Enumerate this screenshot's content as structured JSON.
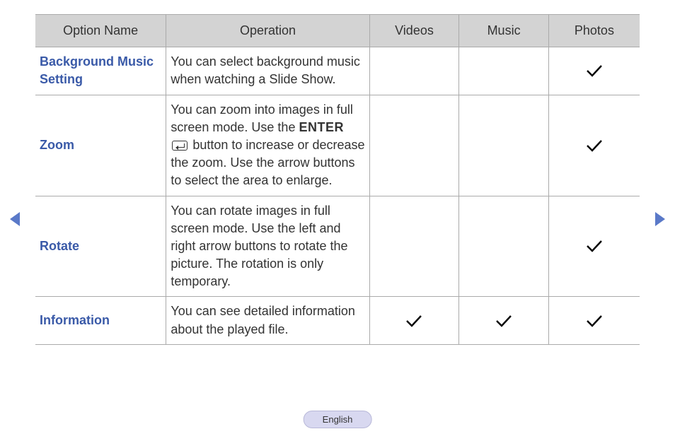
{
  "headers": {
    "option": "Option Name",
    "operation": "Operation",
    "videos": "Videos",
    "music": "Music",
    "photos": "Photos"
  },
  "rows": [
    {
      "name": "Background Music Setting",
      "operation": "You can select background music when watching a Slide Show.",
      "videos": false,
      "music": false,
      "photos": true,
      "has_enter_icon": false
    },
    {
      "name": "Zoom",
      "op_pre": "You can zoom into images in full screen mode. Use the ",
      "op_enter_word": "ENTER",
      "op_post": " button to increase or decrease the zoom. Use the arrow buttons to select the area to enlarge.",
      "videos": false,
      "music": false,
      "photos": true,
      "has_enter_icon": true
    },
    {
      "name": "Rotate",
      "operation": "You can rotate images in full screen mode. Use the left and right arrow buttons to rotate the picture. The rotation is only temporary.",
      "videos": false,
      "music": false,
      "photos": true,
      "has_enter_icon": false
    },
    {
      "name": "Information",
      "operation": "You can see detailed information about the played file.",
      "videos": true,
      "music": true,
      "photos": true,
      "has_enter_icon": false
    }
  ],
  "language": "English"
}
